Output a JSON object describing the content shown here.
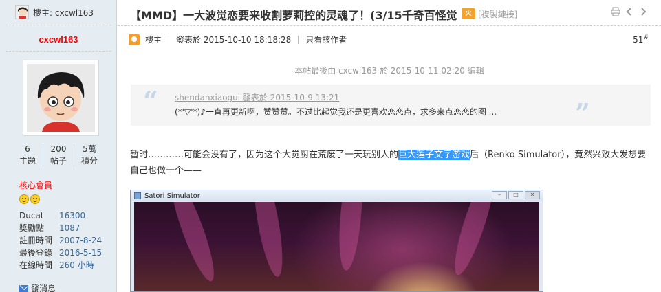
{
  "sidebar": {
    "header_label": "樓主: cxcwl163",
    "username": "cxcwl163",
    "stats": [
      {
        "value": "6",
        "label": "主題"
      },
      {
        "value": "200",
        "label": "帖子"
      },
      {
        "value": "5萬",
        "label": "積分"
      }
    ],
    "group": "核心會員",
    "info": [
      {
        "key": "Ducat",
        "value": "16300"
      },
      {
        "key": "獎勵點",
        "value": "1087"
      },
      {
        "key": "註冊時間",
        "value": "2007-8-24"
      },
      {
        "key": "最後登錄",
        "value": "2016-5-15"
      },
      {
        "key": "在線時間",
        "value": "260 小時"
      }
    ],
    "pm_label": "發消息"
  },
  "post": {
    "title": "【MMD】一大波觉恋要来收割萝莉控的灵魂了！(3/15千奇百怪觉",
    "hot_badge": "火",
    "copy_link": "[複製鏈接]",
    "owner_label": "樓主",
    "posted_at": "發表於 2015-10-10 18:18:28",
    "only_author": "只看該作者",
    "floor": "51",
    "floor_mark": "#",
    "edit_note": "本帖最後由 cxcwl163 於 2015-10-11 02:20 編輯",
    "quote_head": "shendanxiaogui 發表於 2015-10-9 13:21",
    "quote_text": "(*'▽'*)♪一直再更新啊，赞赞赞。不过比起觉我还是更喜欢恋恋点，求多来点恋恋的图 ...",
    "body_before": "暂时…………可能会没有了，因为这个大觉厨在荒废了一天玩别人的",
    "body_highlight": "巨大莲子文字游戏",
    "body_after": "后（Renko Simulator），竟然兴致大发想要自己也做一个——",
    "window_title": "Satori Simulator"
  },
  "icons": [
    "print-icon",
    "prev-thread-icon",
    "next-thread-icon",
    "owner-icon",
    "envelope-icon",
    "smile-icon"
  ],
  "colors": {
    "sidebar_bg": "#e5edf2",
    "username": "#ff0000",
    "link": "#336699",
    "highlight": "#3399ff",
    "quote_mark": "#c5d7e8"
  }
}
